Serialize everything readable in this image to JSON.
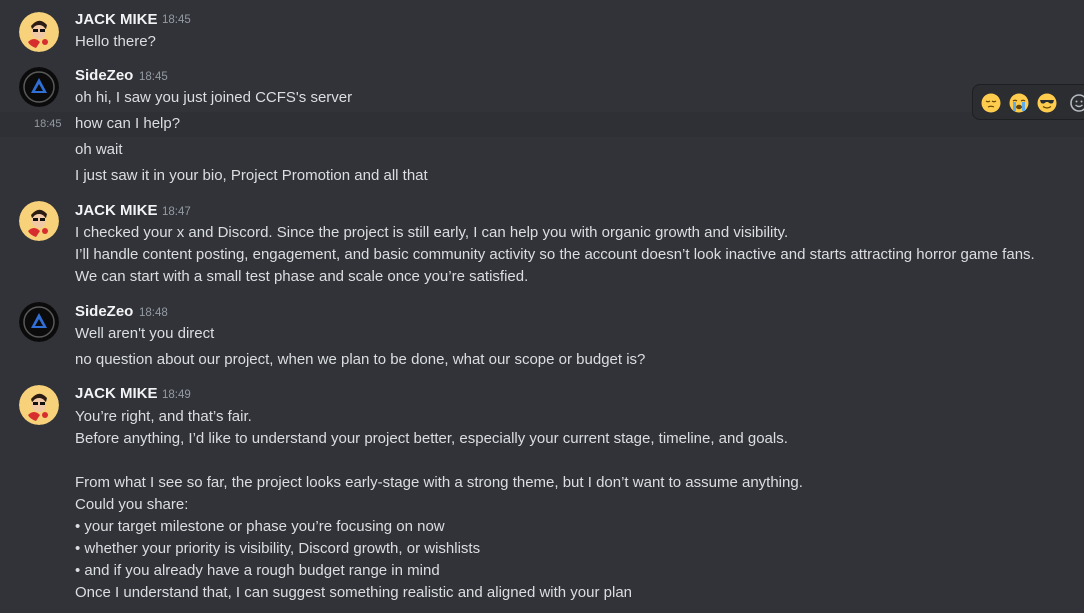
{
  "messages": [
    {
      "author": "JACK MIKE",
      "time": "18:45",
      "lines": [
        "Hello there?"
      ]
    },
    {
      "author": "SideZeo",
      "time": "18:45",
      "lines": [
        "oh hi, I saw you just joined CCFS's server",
        "how can I help?",
        "oh wait",
        "I just saw it in your bio, Project Promotion and all that"
      ],
      "hover_time": "18:45"
    },
    {
      "author": "JACK MIKE",
      "time": "18:47",
      "lines": [
        "I checked your x and Discord. Since the project is still early, I can help you with organic growth and visibility.",
        "I’ll handle content posting, engagement, and basic community activity so the account doesn’t look inactive and starts attracting horror game fans.",
        "We can start with a small test phase and scale once you’re satisfied."
      ]
    },
    {
      "author": "SideZeo",
      "time": "18:48",
      "lines": [
        "Well aren't you direct",
        "no question about our project, when we plan to be done, what our scope or budget is?"
      ]
    },
    {
      "author": "JACK MIKE",
      "time": "18:49",
      "lines": [
        "You’re right, and that’s fair.",
        "Before anything, I’d like to understand your project better, especially your current stage, timeline, and goals.",
        "From what I see so far, the project looks early-stage with a strong theme, but I don’t want to assume anything.",
        "Could you share:",
        "• your target milestone or phase you’re focusing on now",
        "• whether your priority is visibility, Discord growth, or wishlists",
        "• and if you already have a rough budget range in mind",
        "Once I understand that, I can suggest something realistic and aligned with your plan"
      ]
    }
  ],
  "reaction_bar": {
    "emojis": [
      "pensive-face-icon",
      "loudly-crying-face-icon",
      "smiling-face-with-sunglasses-icon",
      "add-reaction-icon"
    ]
  },
  "colors": {
    "background": "#313338",
    "hover_row": "#2e3035",
    "username": "#f2f3f5",
    "message_text": "#dbdee1",
    "timestamp": "#949ba4",
    "emoji_yellow": "#ffcc4d"
  }
}
